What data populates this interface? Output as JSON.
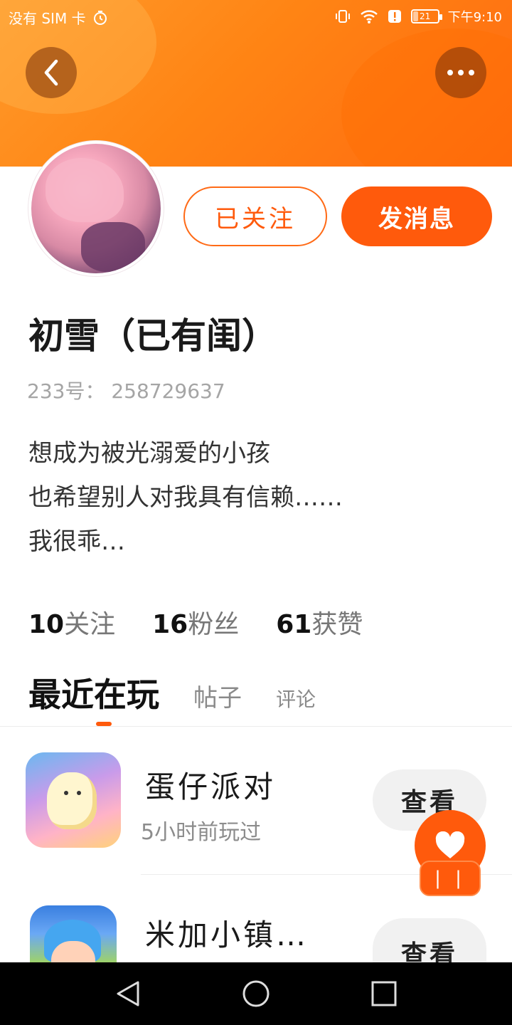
{
  "status_bar": {
    "carrier": "没有 SIM 卡",
    "battery": "21",
    "time": "下午9:10"
  },
  "colors": {
    "accent": "#ff5a0c",
    "header_gradient_start": "#ff9a2a",
    "header_gradient_end": "#ff6a10"
  },
  "icons": {
    "back": "chevron-left-icon",
    "more": "more-dots-icon",
    "like": "heart-icon"
  },
  "profile": {
    "follow_button": "已关注",
    "message_button": "发消息",
    "nickname": "初雪（已有闺）",
    "user_id": "233号： 258729637",
    "bio": [
      "想成为被光溺爱的小孩",
      "也希望别人对我具有信赖……",
      "我很乖…"
    ]
  },
  "stats": [
    {
      "num": "10",
      "label": "关注"
    },
    {
      "num": "16",
      "label": "粉丝"
    },
    {
      "num": "61",
      "label": "获赞"
    }
  ],
  "tabs": [
    "最近在玩",
    "帖子",
    "评论"
  ],
  "games": [
    {
      "title": "蛋仔派对",
      "subtitle": "5小时前玩过",
      "button": "查看"
    },
    {
      "title": "米加小镇…",
      "subtitle": "",
      "button": "查看"
    }
  ],
  "floating": {
    "pill_text": "| |"
  }
}
